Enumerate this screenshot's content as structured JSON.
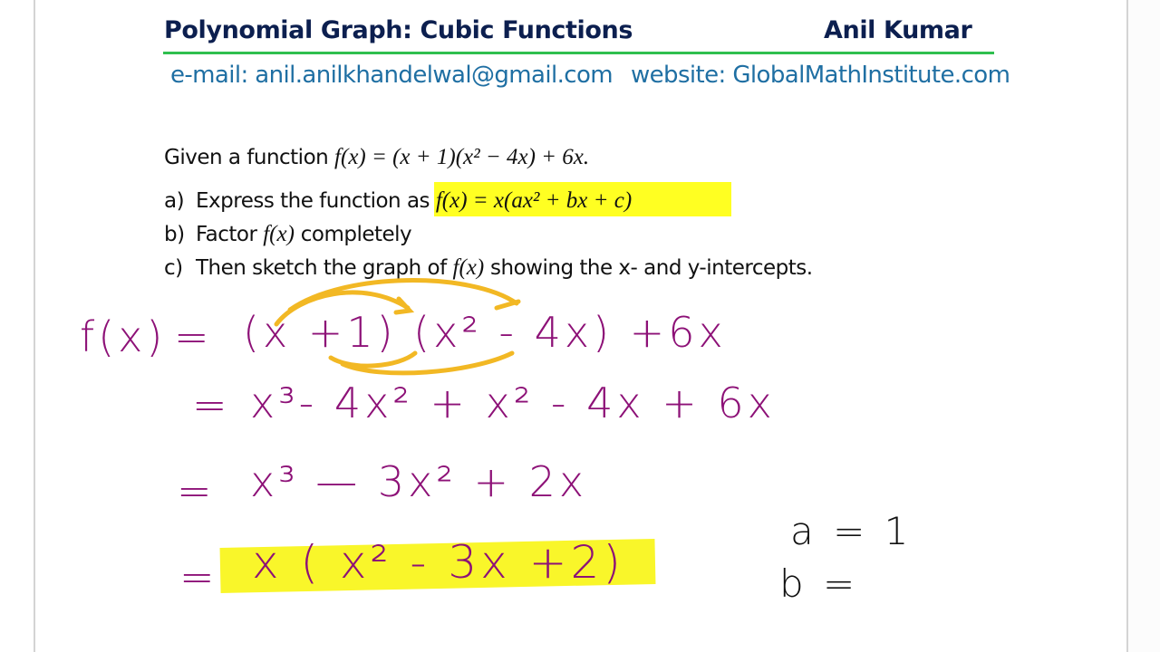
{
  "header": {
    "title": "Polynomial Graph: Cubic Functions",
    "author": "Anil Kumar",
    "email": "e-mail: anil.anilkhandelwal@gmail.com",
    "website": "website: GlobalMathInstitute.com"
  },
  "colors": {
    "title": "#0c1f4f",
    "rule": "#2fbf4f",
    "contact": "#1f6fa3",
    "handwriting": "#8d1177",
    "highlight": "#ffff22",
    "arrows": "#f2b824"
  },
  "problem": {
    "intro_text": "Given a function ",
    "intro_math": "f(x) = (x + 1)(x² − 4x) + 6x.",
    "parts": [
      {
        "label": "a)",
        "text": "Express the function as ",
        "math": "f(x) = x(ax² + bx + c)",
        "text_after": ""
      },
      {
        "label": "b)",
        "text": "Factor ",
        "math": "f(x)",
        "text_after": " completely"
      },
      {
        "label": "c)",
        "text": "Then sketch the graph of ",
        "math": "f(x)",
        "text_after": " showing the x- and y-intercepts."
      }
    ]
  },
  "work": {
    "lines": [
      {
        "lhs": "f(x)",
        "eq": "=",
        "rhs": "(x +1) (x² - 4x)  +6x"
      },
      {
        "eq": "=",
        "rhs": "x³- 4x² + x² - 4x  + 6x"
      },
      {
        "eq": "=",
        "rhs": "x³  — 3x² + 2x"
      },
      {
        "eq": "=",
        "rhs": "x ( x² - 3x  +2)"
      }
    ],
    "side_notes": [
      {
        "text": "a = 1"
      },
      {
        "text": "b ="
      }
    ]
  }
}
